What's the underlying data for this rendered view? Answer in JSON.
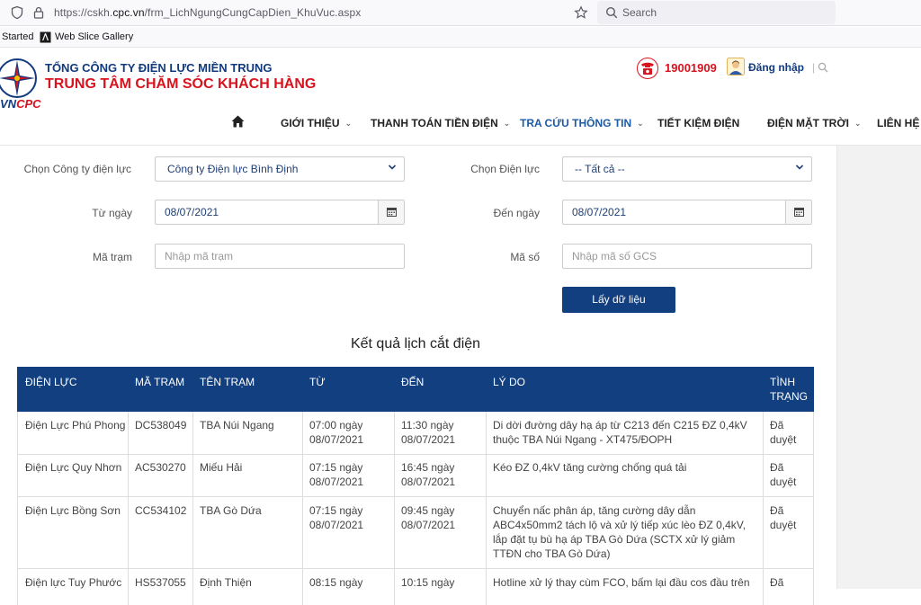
{
  "browser": {
    "url_prefix": "https://cskh.",
    "url_domain": "cpc.vn",
    "url_path": "/frm_LichNgungCungCapDien_KhuVuc.aspx",
    "search_placeholder": "Search",
    "bookmarks": [
      "Started",
      "Web Slice Gallery"
    ]
  },
  "site": {
    "org_line1": "TỔNG CÔNG TY ĐIỆN LỰC MIỀN TRUNG",
    "org_line2": "TRUNG TÂM CHĂM SÓC KHÁCH HÀNG",
    "logo_vn": "VN",
    "logo_cpc": "CPC",
    "hotline": "19001909",
    "login": "Đăng nhập",
    "divider": "|"
  },
  "nav": [
    {
      "label": "GIỚI THIỆU",
      "chevron": true
    },
    {
      "label": "THANH TOÁN TIỀN ĐIỆN",
      "chevron": true
    },
    {
      "label": "TRA CỨU THÔNG TIN",
      "chevron": true,
      "active": true
    },
    {
      "label": "TIẾT KIỆM ĐIỆN",
      "chevron": false
    },
    {
      "label": "ĐIỆN MẶT TRỜI",
      "chevron": true
    },
    {
      "label": "LIÊN HỆ",
      "chevron": false
    }
  ],
  "form": {
    "company_label": "Chọn Công ty điện lực",
    "company_value": "Công ty Điện lực Bình Định",
    "branch_label": "Chọn Điện lực",
    "branch_value": "-- Tất cả --",
    "from_label": "Từ ngày",
    "from_value": "08/07/2021",
    "to_label": "Đến ngày",
    "to_value": "08/07/2021",
    "station_label": "Mã trạm",
    "station_placeholder": "Nhập mã trạm",
    "code_label": "Mã số",
    "code_placeholder": "Nhập mã số GCS",
    "submit": "Lấy dữ liệu"
  },
  "results": {
    "title": "Kết quả lịch cắt điện",
    "headers": [
      "ĐIỆN LỰC",
      "MÃ TRẠM",
      "TÊN TRẠM",
      "TỪ",
      "ĐẾN",
      "LÝ DO",
      "TÌNH TRẠNG"
    ],
    "rows": [
      {
        "dl": "Điện Lực Phú Phong",
        "ma": "DC538049",
        "ten": "TBA Núi Ngang",
        "tu": "07:00 ngày 08/07/2021",
        "den": "11:30 ngày 08/07/2021",
        "lydo": "Di dời đường dây hạ áp từ C213 đến C215 ĐZ 0,4kV thuộc TBA Núi Ngang - XT475/ĐOPH",
        "tt": "Đã duyệt"
      },
      {
        "dl": "Điện Lực Quy Nhơn",
        "ma": "AC530270",
        "ten": "Miếu Hải",
        "tu": "07:15 ngày 08/07/2021",
        "den": "16:45 ngày 08/07/2021",
        "lydo": "Kéo ĐZ 0,4kV tăng cường chống quá tải",
        "tt": "Đã duyệt"
      },
      {
        "dl": "Điện Lực Bồng Sơn",
        "ma": "CC534102",
        "ten": "TBA Gò Dứa",
        "tu": "07:15 ngày 08/07/2021",
        "den": "09:45 ngày 08/07/2021",
        "lydo": "Chuyển nấc phân áp, tăng cường dây dẫn ABC4x50mm2 tách lộ và xử lý tiếp xúc lèo ĐZ 0,4kV, lắp đặt tụ bù hạ áp TBA Gò Dứa (SCTX xử lý giảm TTĐN cho TBA Gò Dứa)",
        "tt": "Đã duyệt"
      },
      {
        "dl": "Điện lực Tuy Phước",
        "ma": "HS537055",
        "ten": "Định Thiện",
        "tu": "08:15 ngày",
        "den": "10:15 ngày",
        "lydo": "Hotline xử lý thay cùm FCO, bấm lại đầu cos đầu trên",
        "tt": "Đã"
      }
    ]
  },
  "colors": {
    "primary": "#123f7f",
    "accent": "#d7131e",
    "active_nav": "#1c5aa6"
  }
}
